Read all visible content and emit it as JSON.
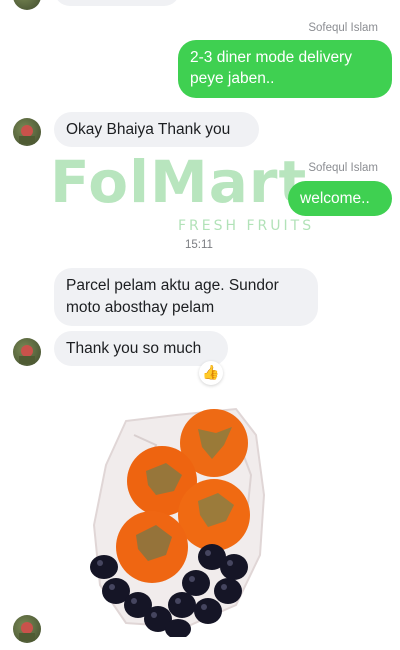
{
  "colors": {
    "outgoing_bubble": "#3fd051",
    "incoming_bubble": "#f0f1f4",
    "watermark_green": "#7fd08a"
  },
  "watermark": {
    "brand": "FolMart",
    "tagline": "FRESH FRUITS"
  },
  "messages": [
    {
      "sender": "Sofequl Islam",
      "text_line1": "2-3 diner mode delivery",
      "text_line2": "peye jaben.."
    },
    {
      "text": "Okay Bhaiya Thank you"
    },
    {
      "sender": "Sofequl Islam",
      "text": "welcome.."
    },
    {
      "timestamp": "15:11"
    },
    {
      "text_line1": "Parcel pelam aktu age. Sundor",
      "text_line2": "moto abosthay pelam"
    },
    {
      "text": "Thank you so much",
      "reaction": "thumbs-up"
    },
    {
      "attachment": "photo of persimmons and black grapes"
    }
  ]
}
